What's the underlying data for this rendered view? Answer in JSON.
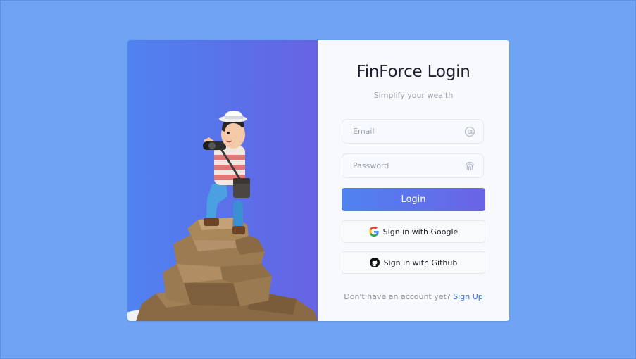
{
  "app": {
    "title": "FinForce Login",
    "subtitle": "Simplify your wealth"
  },
  "form": {
    "email": {
      "placeholder": "Email",
      "icon": "at-icon"
    },
    "password": {
      "placeholder": "Password",
      "icon": "fingerprint-icon"
    },
    "login_label": "Login",
    "google_label": "Sign in with Google",
    "github_label": "Sign in with Github",
    "signup_prompt": "Don't have an account yet?",
    "signup_link": "Sign Up"
  },
  "hero": {
    "illustration": "explorer-with-binoculars-on-rock"
  },
  "colors": {
    "background": "#6fa4f5",
    "accent_start": "#4f83f0",
    "accent_end": "#6b63e6",
    "link": "#3a6fe0"
  }
}
